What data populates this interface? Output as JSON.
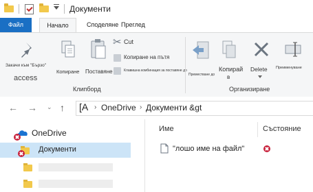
{
  "window": {
    "title": "Документи"
  },
  "tabs": {
    "file": "Файл",
    "home": "Начало",
    "share": "Споделяне",
    "view": "Преглед"
  },
  "ribbon": {
    "pin_label": "Закачи към \"Бързо\"",
    "pin_sub": "access",
    "copy_label": "Копиране",
    "paste_label": "Поставяне",
    "cut_label": "Cut",
    "copy_path_label": "Копиране на пътя",
    "paste_shortcut_label": "Клавишна комбинация за поставяне до",
    "move_to_label": "Преместване до",
    "copy_to_label": "Копирай",
    "copy_to_sub": "в",
    "delete_label": "Delete",
    "rename_label": "Преименуване",
    "clipboard_group": "Клипборд",
    "organize_group": "Организиране"
  },
  "address": {
    "root": "[A",
    "crumb1": "OneDrive",
    "crumb2": "Документи &gt"
  },
  "navpane": {
    "onedrive": "OneDrive",
    "documents": "Документи"
  },
  "filelist": {
    "col_name": "Име",
    "col_status": "Състояние",
    "file_name": "\"лошо име на файл\""
  }
}
